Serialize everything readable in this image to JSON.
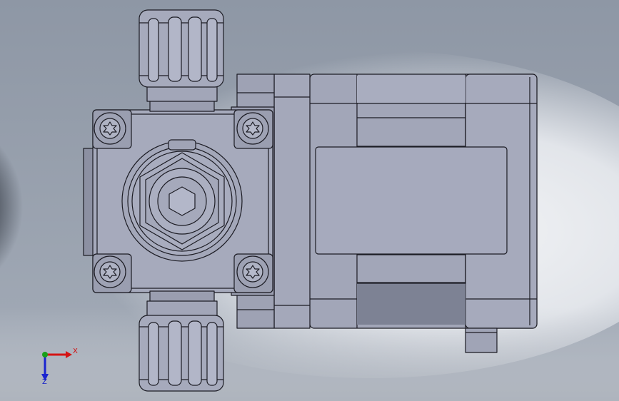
{
  "triad": {
    "x_label": "X",
    "z_label": "Z",
    "x_color": "#d41414",
    "y_color": "#18a018",
    "z_color": "#1a24d0"
  },
  "colors": {
    "part_fill": "#a2a6b8",
    "part_light": "#b4b8ca",
    "part_dark": "#6e7284",
    "edge": "#1c1c24",
    "background_light": "#e6e9ee",
    "background_dark": "#2a2f37"
  }
}
